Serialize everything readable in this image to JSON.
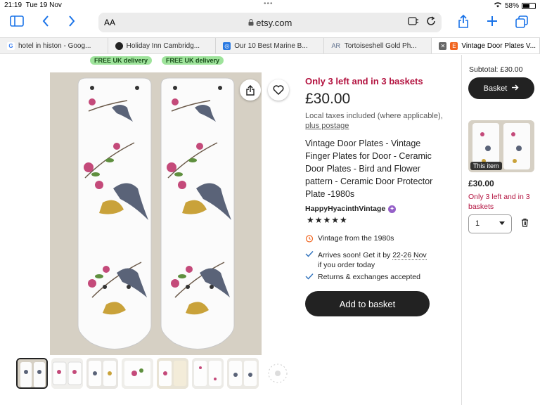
{
  "status": {
    "time": "21:19",
    "date": "Tue 19 Nov",
    "battery": "58%",
    "battery_level": 0.58
  },
  "browser": {
    "text_size_label": "AA",
    "url": "etsy.com",
    "tabs": [
      {
        "label": "hotel in histon - Goog...",
        "favicon": "G",
        "color": "#4285f4"
      },
      {
        "label": "Holiday Inn Cambridg...",
        "favicon": "●",
        "color": "#222"
      },
      {
        "label": "Our 10 Best Marine B...",
        "favicon": "◎",
        "color": "#2a7ae2"
      },
      {
        "label": "Tortoiseshell Gold Ph...",
        "favicon": "AR",
        "color": "#5a6c8a"
      },
      {
        "label": "Vintage Door Plates V...",
        "favicon": "E",
        "color": "#f1641e"
      }
    ]
  },
  "delivery_badges": [
    "FREE UK delivery",
    "FREE UK delivery"
  ],
  "listing": {
    "scarcity": "Only 3 left and in 3 baskets",
    "price": "£30.00",
    "taxes_text": "Local taxes included (where applicable),",
    "plus_postage": "plus postage",
    "title": "Vintage Door Plates - Vintage Finger Plates for Door - Ceramic Door Plates - Bird and Flower pattern - Ceramic Door Protector Plate -1980s",
    "shop_name": "HappyHyacinthVintage",
    "stars": "★★★★★",
    "rating": 5,
    "features": {
      "vintage": "Vintage from the 1980s",
      "arrives_prefix": "Arrives soon! Get it by",
      "arrives_date": "22-26 Nov",
      "arrives_suffix": "if you order today",
      "returns": "Returns & exchanges accepted"
    },
    "add_to_basket": "Add to basket"
  },
  "cart": {
    "subtotal": "Subtotal: £30.00",
    "basket_button": "Basket",
    "this_item": "This item",
    "item_price": "£30.00",
    "item_scarcity": "Only 3 left and in 3 baskets",
    "quantity": "1"
  }
}
